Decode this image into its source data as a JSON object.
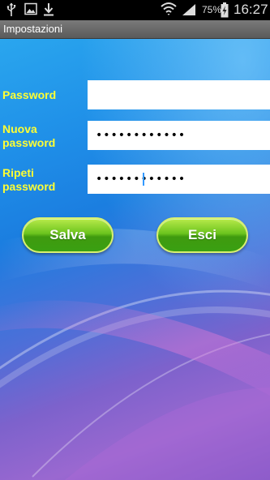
{
  "status_bar": {
    "icons": [
      "usb-icon",
      "image-icon",
      "download-icon",
      "wifi-icon",
      "signal-icon",
      "battery-charging-icon"
    ],
    "battery_percent": "75%",
    "time": "16:27"
  },
  "title_bar": {
    "title": "Impostazioni"
  },
  "form": {
    "password_label": "Password",
    "new_password_label_line1": "Nuova",
    "new_password_label_line2": "password",
    "repeat_password_label_line1": "Ripeti",
    "repeat_password_label_line2": "password",
    "password_value": "",
    "new_password_value": "••••••••••••",
    "repeat_password_value": "••••••••••••"
  },
  "buttons": {
    "save_label": "Salva",
    "exit_label": "Esci"
  },
  "colors": {
    "label": "#ffff33",
    "button_green": "#6cc41e",
    "caret": "#3399ff"
  }
}
